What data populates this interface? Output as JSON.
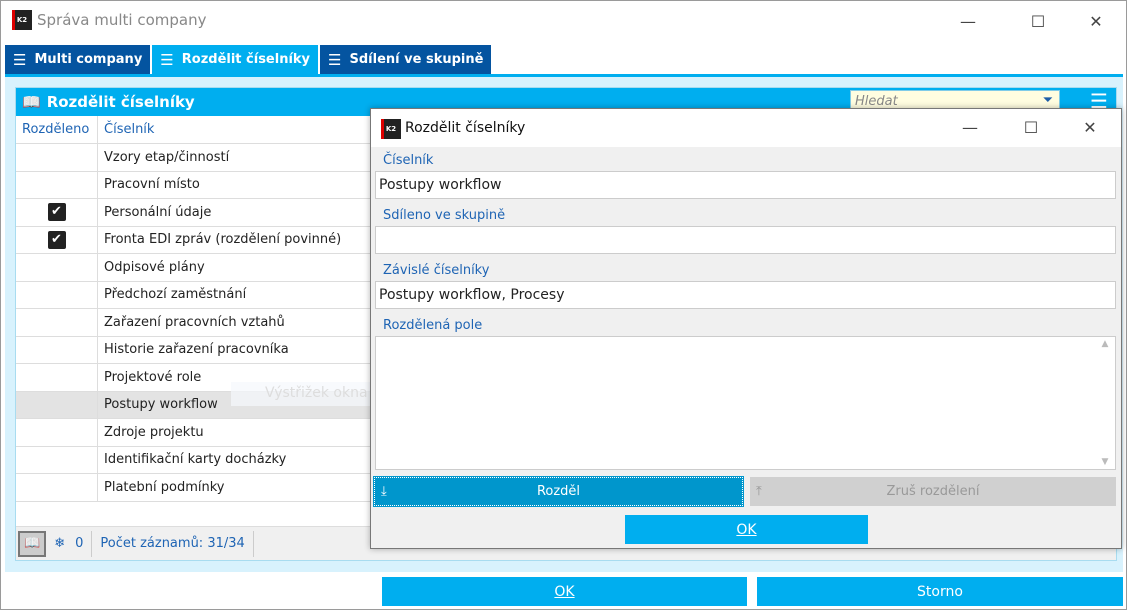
{
  "window": {
    "title": "Správa multi company",
    "logo": "K2"
  },
  "tabs": [
    {
      "label": "Multi company",
      "active": false
    },
    {
      "label": "Rozdělit číselníky",
      "active": true
    },
    {
      "label": "Sdílení ve skupině",
      "active": false
    }
  ],
  "panel": {
    "title": "Rozdělit číselníky",
    "search_placeholder": "Hledat",
    "columns": [
      "Rozděleno",
      "Číselník"
    ],
    "rows": [
      {
        "checked": false,
        "name": "Vzory etap/činností"
      },
      {
        "checked": false,
        "name": "Pracovní místo"
      },
      {
        "checked": true,
        "name": "Personální údaje"
      },
      {
        "checked": true,
        "name": "Fronta EDI zpráv (rozdělení povinné)"
      },
      {
        "checked": false,
        "name": "Odpisové plány"
      },
      {
        "checked": false,
        "name": "Předchozí zaměstnání"
      },
      {
        "checked": false,
        "name": "Zařazení pracovních vztahů"
      },
      {
        "checked": false,
        "name": "Historie zařazení pracovníka"
      },
      {
        "checked": false,
        "name": "Projektové role"
      },
      {
        "checked": false,
        "name": "Postupy workflow",
        "selected": true
      },
      {
        "checked": false,
        "name": "Zdroje projektu"
      },
      {
        "checked": false,
        "name": "Identifikační karty docházky"
      },
      {
        "checked": false,
        "name": "Platební podmínky"
      }
    ],
    "status": {
      "marked_count": "0",
      "record_count": "Počet záznamů: 31/34"
    }
  },
  "ghost_text": "Výstřižek okna",
  "footer": {
    "ok": "OK",
    "cancel": "Storno"
  },
  "dialog": {
    "title": "Rozdělit číselníky",
    "fields": [
      {
        "label": "Číselník",
        "value": "Postupy workflow"
      },
      {
        "label": "Sdíleno ve skupině",
        "value": ""
      },
      {
        "label": "Závislé číselníky",
        "value": "Postupy workflow, Procesy"
      },
      {
        "label": "Rozdělená pole",
        "value": ""
      }
    ],
    "split_button": "Rozděl",
    "unsplit_button": "Zruš rozdělení",
    "ok": "OK"
  },
  "colors": {
    "accent": "#00aeef",
    "tab_dark": "#0454a0",
    "label_blue": "#1e64b4"
  }
}
